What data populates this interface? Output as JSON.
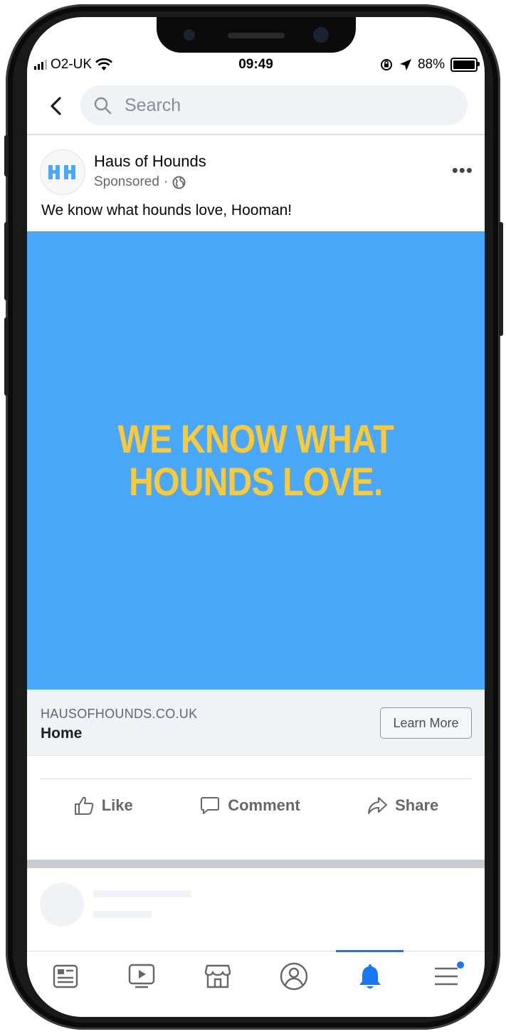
{
  "status_bar": {
    "carrier": "O2-UK",
    "time": "09:49",
    "battery": "88%"
  },
  "search": {
    "placeholder": "Search"
  },
  "post": {
    "page_name": "Haus of Hounds",
    "sponsored_label": "Sponsored",
    "separator": "·",
    "message": "We know what hounds love, Hooman!",
    "creative_headline_line1": "WE KNOW WHAT",
    "creative_headline_line2": "HOUNDS LOVE.",
    "link_domain": "HAUSOFHOUNDS.CO.UK",
    "link_title": "Home",
    "cta_label": "Learn More",
    "more_glyph": "•••",
    "avatar_text": "HH"
  },
  "actions": {
    "like": "Like",
    "comment": "Comment",
    "share": "Share"
  },
  "tabbar": {
    "items": [
      "news-feed",
      "watch",
      "marketplace",
      "profile",
      "notifications",
      "menu"
    ],
    "active": "notifications"
  },
  "colors": {
    "creative_bg": "#4aa8fb",
    "creative_text": "#fcc937",
    "accent": "#1877f2",
    "logo_blue": "#4aa8fb"
  }
}
